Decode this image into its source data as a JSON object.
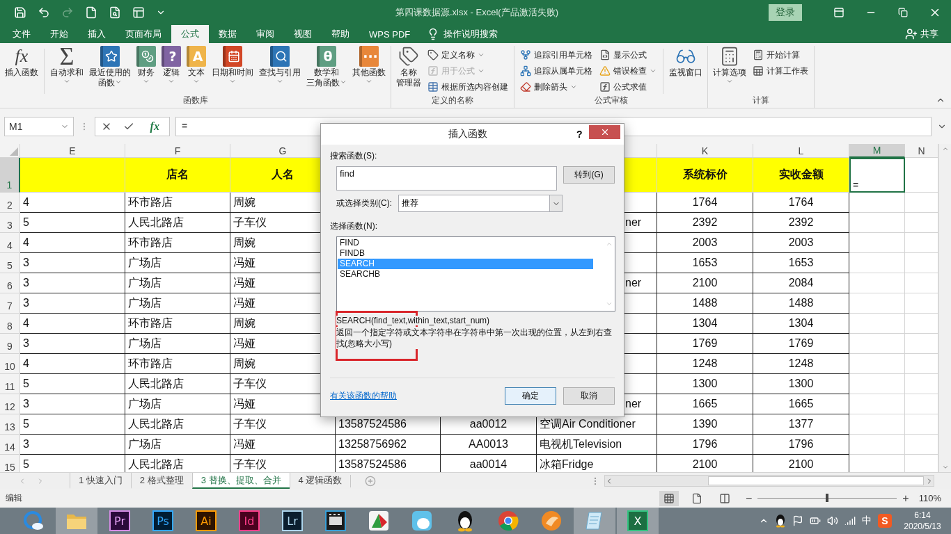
{
  "title_bar": {
    "title": "第四课数据源.xlsx  -  Excel(产品激活失败)",
    "sign_in": "登录"
  },
  "ribbon_tabs": [
    {
      "label": "文件",
      "selected": false
    },
    {
      "label": "开始",
      "selected": false
    },
    {
      "label": "插入",
      "selected": false
    },
    {
      "label": "页面布局",
      "selected": false
    },
    {
      "label": "公式",
      "selected": true
    },
    {
      "label": "数据",
      "selected": false
    },
    {
      "label": "审阅",
      "selected": false
    },
    {
      "label": "视图",
      "selected": false
    },
    {
      "label": "帮助",
      "selected": false
    },
    {
      "label": "WPS PDF",
      "selected": false
    }
  ],
  "tell_me": "操作说明搜索",
  "share": "共享",
  "ribbon": {
    "groups": [
      {
        "label": "函数库",
        "items": [
          {
            "kind": "large",
            "lines": [
              "插入函数"
            ],
            "glyph": "fx",
            "dropdown": false
          },
          {
            "kind": "large",
            "lines": [
              "自动求和"
            ],
            "glyph": "Σ",
            "dropdown": true
          },
          {
            "kind": "large",
            "lines": [
              "最近使用的",
              "函数"
            ],
            "dropdown": true
          },
          {
            "kind": "large",
            "lines": [
              "财务"
            ],
            "dropdown": true
          },
          {
            "kind": "large",
            "lines": [
              "逻辑"
            ],
            "glyph": "?",
            "dropdown": true
          },
          {
            "kind": "large",
            "lines": [
              "文本"
            ],
            "glyph": "A",
            "dropdown": true
          },
          {
            "kind": "large",
            "lines": [
              "日期和时间"
            ],
            "dropdown": true
          },
          {
            "kind": "large",
            "lines": [
              "查找与引用"
            ],
            "dropdown": true
          },
          {
            "kind": "large",
            "lines": [
              "数学和",
              "三角函数"
            ],
            "glyph": "θ",
            "dropdown": true
          },
          {
            "kind": "large",
            "lines": [
              "其他函数"
            ],
            "glyph": "···",
            "dropdown": true
          }
        ]
      },
      {
        "label": "定义的名称",
        "items": [
          {
            "kind": "large",
            "lines": [
              "名称",
              "管理器"
            ],
            "dropdown": false
          },
          {
            "kind": "small",
            "label": "定义名称",
            "dropdown": true,
            "disabled": false
          },
          {
            "kind": "small",
            "label": "用于公式",
            "dropdown": true,
            "disabled": true
          },
          {
            "kind": "small",
            "label": "根据所选内容创建",
            "dropdown": false,
            "disabled": false
          }
        ]
      },
      {
        "label": "公式审核",
        "items": [
          {
            "kind": "small",
            "label": "追踪引用单元格",
            "dropdown": false,
            "disabled": false
          },
          {
            "kind": "small",
            "label": "追踪从属单元格",
            "dropdown": false,
            "disabled": false
          },
          {
            "kind": "small",
            "label": "删除箭头",
            "dropdown": true,
            "disabled": false
          },
          {
            "kind": "small",
            "label": "显示公式",
            "dropdown": false,
            "disabled": false
          },
          {
            "kind": "small",
            "label": "错误检查",
            "dropdown": true,
            "disabled": false
          },
          {
            "kind": "small",
            "label": "公式求值",
            "dropdown": false,
            "disabled": false
          },
          {
            "kind": "large",
            "lines": [
              "监视窗口"
            ],
            "dropdown": false
          }
        ]
      },
      {
        "label": "计算",
        "items": [
          {
            "kind": "large",
            "lines": [
              "计算选项"
            ],
            "dropdown": true
          },
          {
            "kind": "small",
            "label": "开始计算",
            "dropdown": false,
            "disabled": false
          },
          {
            "kind": "small",
            "label": "计算工作表",
            "dropdown": false,
            "disabled": false
          }
        ]
      }
    ]
  },
  "formula_bar": {
    "name_box": "M1",
    "fx": "fx",
    "value": "="
  },
  "sheet": {
    "columns": [
      "E",
      "F",
      "G",
      null,
      null,
      null,
      "K",
      "L",
      "M",
      "N"
    ],
    "rows": [
      {
        "number": "1",
        "kind": "header",
        "cells": [
          null,
          "店名",
          "人名",
          null,
          null,
          null,
          "系统标价",
          "实收金额",
          {
            "text": "=",
            "selected": true
          },
          null
        ]
      },
      {
        "number": "2",
        "kind": "data",
        "cells": [
          "4",
          "环市路店",
          "周婉",
          null,
          null,
          null,
          "1764",
          "1764",
          null,
          null
        ]
      },
      {
        "number": "3",
        "kind": "data",
        "cells": [
          "5",
          "人民北路店",
          "子车仪",
          null,
          null,
          {
            "text": "ner",
            "kind": "cut"
          },
          "2392",
          "2392",
          null,
          null
        ]
      },
      {
        "number": "4",
        "kind": "data",
        "cells": [
          "4",
          "环市路店",
          "周婉",
          null,
          null,
          null,
          "2003",
          "2003",
          null,
          null
        ]
      },
      {
        "number": "5",
        "kind": "data",
        "cells": [
          "3",
          "广场店",
          "冯娅",
          null,
          null,
          null,
          "1653",
          "1653",
          null,
          null
        ]
      },
      {
        "number": "6",
        "kind": "data",
        "cells": [
          "3",
          "广场店",
          "冯娅",
          null,
          null,
          {
            "text": "ner",
            "kind": "cut"
          },
          "2100",
          "2084",
          null,
          null
        ]
      },
      {
        "number": "7",
        "kind": "data",
        "cells": [
          "3",
          "广场店",
          "冯娅",
          null,
          null,
          null,
          "1488",
          "1488",
          null,
          null
        ]
      },
      {
        "number": "8",
        "kind": "data",
        "cells": [
          "4",
          "环市路店",
          "周婉",
          null,
          null,
          null,
          "1304",
          "1304",
          null,
          null
        ]
      },
      {
        "number": "9",
        "kind": "data",
        "cells": [
          "3",
          "广场店",
          "冯娅",
          null,
          null,
          null,
          "1769",
          "1769",
          null,
          null
        ]
      },
      {
        "number": "10",
        "kind": "data",
        "cells": [
          "4",
          "环市路店",
          "周婉",
          null,
          null,
          null,
          "1248",
          "1248",
          null,
          null
        ]
      },
      {
        "number": "11",
        "kind": "data",
        "cells": [
          "5",
          "人民北路店",
          "子车仪",
          null,
          null,
          null,
          "1300",
          "1300",
          null,
          null
        ]
      },
      {
        "number": "12",
        "kind": "data",
        "cells": [
          "3",
          "广场店",
          "冯娅",
          null,
          null,
          {
            "text": "ner",
            "kind": "cut"
          },
          "1665",
          "1665",
          null,
          null
        ]
      },
      {
        "number": "13",
        "kind": "data",
        "cells": [
          "5",
          "人民北路店",
          "子车仪",
          "13587524586",
          "aa0012",
          "空调Air Conditioner",
          "1390",
          "1377",
          null,
          null
        ]
      },
      {
        "number": "14",
        "kind": "data",
        "cells": [
          "3",
          "广场店",
          "冯娅",
          "13258756962",
          "AA0013",
          "电视机Television",
          "1796",
          "1796",
          null,
          null
        ]
      },
      {
        "number": "15",
        "kind": "data",
        "cells": [
          "5",
          "人民北路店",
          "子车仪",
          "13587524586",
          "aa0014",
          "冰箱Fridge",
          "2100",
          "2100",
          null,
          null
        ]
      }
    ]
  },
  "dialog": {
    "title": "插入函数",
    "help": "?",
    "search_label": "搜索函数(S):",
    "search_value": "find",
    "go_button": "转到(G)",
    "category_label": "或选择类别(C):",
    "category_value": "推荐",
    "list_label": "选择函数(N):",
    "functions": [
      {
        "label": "FIND",
        "selected": false
      },
      {
        "label": "FINDB",
        "selected": false
      },
      {
        "label": "SEARCH",
        "selected": true
      },
      {
        "label": "SEARCHB",
        "selected": false
      }
    ],
    "signature": "SEARCH(find_text,within_text,start_num)",
    "description": "返回一个指定字符或文本字符串在字符串中第一次出现的位置，从左到右查找(忽略大小写)",
    "highlight_frame": true,
    "help_link": "有关该函数的帮助",
    "buttons": [
      {
        "label": "确定",
        "default": true
      },
      {
        "label": "取消",
        "default": false
      }
    ]
  },
  "sheet_tabs": [
    {
      "label": "1 快速入门",
      "selected": false
    },
    {
      "label": "2 格式整理",
      "selected": false
    },
    {
      "label": "3 替换、提取、合并",
      "selected": true
    },
    {
      "label": "4 逻辑函数",
      "selected": false
    }
  ],
  "status_bar": {
    "mode": "编辑",
    "views": [
      {
        "selected": true
      },
      {
        "selected": false
      },
      {
        "selected": false
      }
    ],
    "zoom_out": "−",
    "zoom_in": "+",
    "zoom": {
      "level": 0.5
    },
    "zoom_text": "110%"
  },
  "taskbar": {
    "apps": [
      {
        "kind": "icon",
        "active": false
      },
      {
        "kind": "icon",
        "active": true
      },
      {
        "kind": "badge",
        "label": "Pr",
        "active": false
      },
      {
        "kind": "badge",
        "label": "Ps",
        "active": false
      },
      {
        "kind": "badge",
        "label": "Ai",
        "active": false
      },
      {
        "kind": "badge",
        "label": "Id",
        "active": false
      },
      {
        "kind": "badge",
        "label": "Lr",
        "active": false
      },
      {
        "kind": "icon",
        "active": false
      },
      {
        "kind": "icon",
        "active": false
      },
      {
        "kind": "icon",
        "active": false
      },
      {
        "kind": "icon",
        "active": false
      },
      {
        "kind": "icon",
        "active": false
      },
      {
        "kind": "icon",
        "active": false
      },
      {
        "kind": "icon",
        "active": true
      },
      {
        "kind": "badge",
        "label": "X",
        "active": true
      }
    ],
    "input_method": "中",
    "ime_badge": "S",
    "time": "6:14",
    "date": "2020/5/13"
  }
}
